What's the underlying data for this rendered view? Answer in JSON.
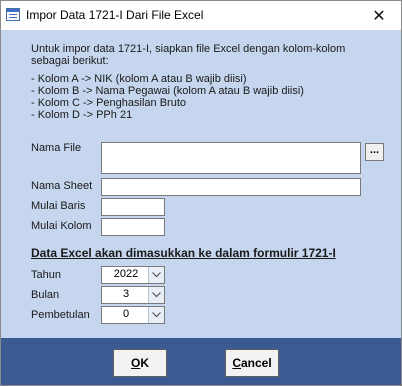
{
  "window": {
    "title": "Impor Data 1721-I Dari File Excel",
    "close_glyph": "✕"
  },
  "instructions": {
    "line1": "Untuk impor data 1721-I, siapkan file Excel dengan kolom-kolom",
    "line2": "sebagai berikut:",
    "col_a": "- Kolom A -> NIK (kolom A atau B wajib diisi)",
    "col_b": "- Kolom B -> Nama Pegawai (kolom A atau B wajib diisi)",
    "col_c": "- Kolom C -> Penghasilan Bruto",
    "col_d": "- Kolom D -> PPh 21"
  },
  "fields": {
    "nama_file": {
      "label": "Nama File",
      "value": ""
    },
    "nama_sheet": {
      "label": "Nama Sheet",
      "value": ""
    },
    "mulai_baris": {
      "label": "Mulai Baris",
      "value": ""
    },
    "mulai_kolom": {
      "label": "Mulai Kolom",
      "value": ""
    },
    "browse_label": "..."
  },
  "section": {
    "title": "Data Excel akan dimasukkan ke dalam formulir 1721-I"
  },
  "selects": {
    "tahun": {
      "label": "Tahun",
      "value": "2022"
    },
    "bulan": {
      "label": "Bulan",
      "value": "3"
    },
    "pembetulan": {
      "label": "Pembetulan",
      "value": "0"
    }
  },
  "buttons": {
    "ok_mnemonic": "O",
    "ok_rest": "K",
    "cancel_mnemonic": "C",
    "cancel_rest": "ancel"
  },
  "colors": {
    "dialog_bg": "#c5d6ee",
    "footer_bg": "#3c5a92"
  },
  "icons": {
    "app": "form-icon",
    "close": "close-icon",
    "dropdown": "chevron-down-icon"
  }
}
